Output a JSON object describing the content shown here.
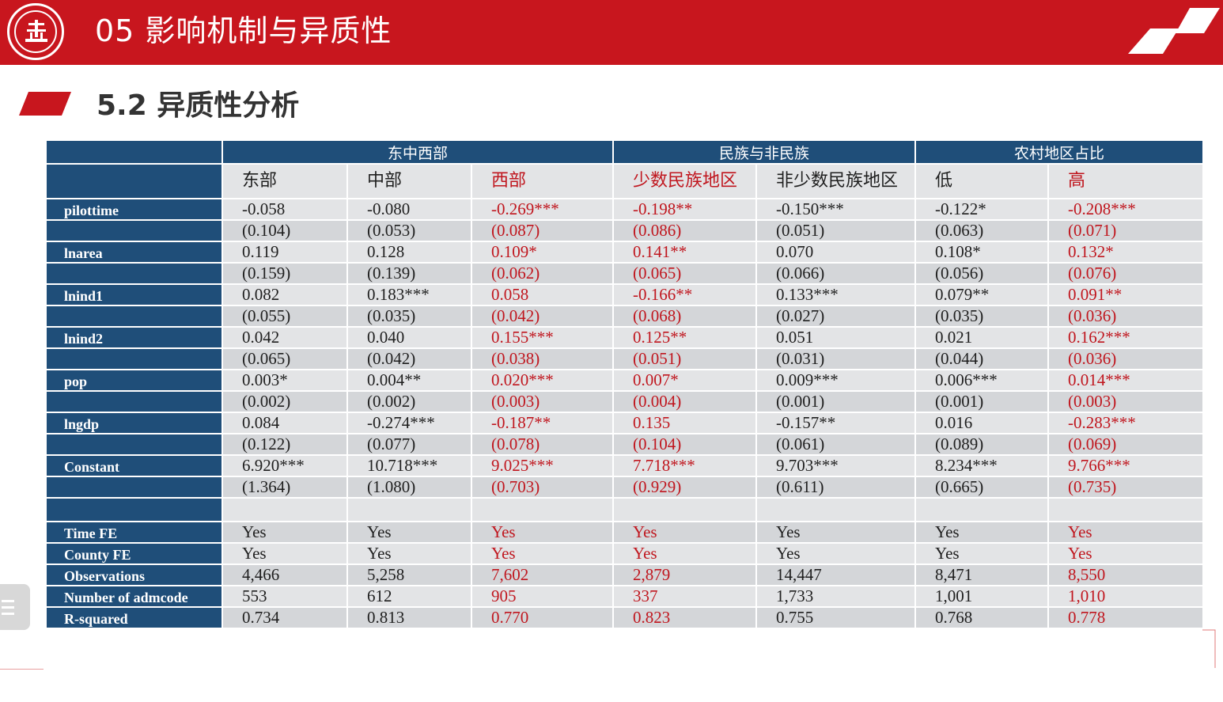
{
  "header": {
    "title": "05 影响机制与异质性"
  },
  "section": {
    "title": "5.2 异质性分析"
  },
  "colors": {
    "accent": "#c8161e",
    "table_header": "#1f4e79",
    "highlight_text": "#c0161e"
  },
  "table": {
    "groups": [
      "东中西部",
      "民族与非民族",
      "农村地区占比"
    ],
    "columns": [
      {
        "label": "东部",
        "highlight": false
      },
      {
        "label": "中部",
        "highlight": false
      },
      {
        "label": "西部",
        "highlight": true
      },
      {
        "label": "少数民族地区",
        "highlight": true
      },
      {
        "label": "非少数民族地区",
        "highlight": false
      },
      {
        "label": "低",
        "highlight": false
      },
      {
        "label": "高",
        "highlight": true
      }
    ],
    "rows": [
      {
        "label": "pilottime",
        "values": [
          "-0.058",
          "-0.080",
          "-0.269***",
          "-0.198**",
          "-0.150***",
          "-0.122*",
          "-0.208***"
        ]
      },
      {
        "label": "",
        "values": [
          "(0.104)",
          "(0.053)",
          "(0.087)",
          "(0.086)",
          "(0.051)",
          "(0.063)",
          "(0.071)"
        ]
      },
      {
        "label": "lnarea",
        "values": [
          "0.119",
          "0.128",
          "0.109*",
          "0.141**",
          "0.070",
          "0.108*",
          "0.132*"
        ]
      },
      {
        "label": "",
        "values": [
          "(0.159)",
          "(0.139)",
          "(0.062)",
          "(0.065)",
          "(0.066)",
          "(0.056)",
          "(0.076)"
        ]
      },
      {
        "label": "lnind1",
        "values": [
          "0.082",
          "0.183***",
          "0.058",
          "-0.166**",
          "0.133***",
          "0.079**",
          "0.091**"
        ]
      },
      {
        "label": "",
        "values": [
          "(0.055)",
          "(0.035)",
          "(0.042)",
          "(0.068)",
          "(0.027)",
          "(0.035)",
          "(0.036)"
        ]
      },
      {
        "label": "lnind2",
        "values": [
          "0.042",
          "0.040",
          "0.155***",
          "0.125**",
          "0.051",
          "0.021",
          "0.162***"
        ]
      },
      {
        "label": "",
        "values": [
          "(0.065)",
          "(0.042)",
          "(0.038)",
          "(0.051)",
          "(0.031)",
          "(0.044)",
          "(0.036)"
        ]
      },
      {
        "label": "pop",
        "values": [
          "0.003*",
          "0.004**",
          "0.020***",
          "0.007*",
          "0.009***",
          "0.006***",
          "0.014***"
        ]
      },
      {
        "label": "",
        "values": [
          "(0.002)",
          "(0.002)",
          "(0.003)",
          "(0.004)",
          "(0.001)",
          "(0.001)",
          "(0.003)"
        ]
      },
      {
        "label": "lngdp",
        "values": [
          "0.084",
          "-0.274***",
          "-0.187**",
          "0.135",
          "-0.157**",
          "0.016",
          "-0.283***"
        ]
      },
      {
        "label": "",
        "values": [
          "(0.122)",
          "(0.077)",
          "(0.078)",
          "(0.104)",
          "(0.061)",
          "(0.089)",
          "(0.069)"
        ]
      },
      {
        "label": "Constant",
        "values": [
          "6.920***",
          "10.718***",
          "9.025***",
          "7.718***",
          "9.703***",
          "8.234***",
          "9.766***"
        ]
      },
      {
        "label": "",
        "values": [
          "(1.364)",
          "(1.080)",
          "(0.703)",
          "(0.929)",
          "(0.611)",
          "(0.665)",
          "(0.735)"
        ]
      },
      {
        "label": "",
        "values": [
          "",
          "",
          "",
          "",
          "",
          "",
          ""
        ]
      },
      {
        "label": "Time FE",
        "values": [
          "Yes",
          "Yes",
          "Yes",
          "Yes",
          "Yes",
          "Yes",
          "Yes"
        ]
      },
      {
        "label": "County FE",
        "values": [
          "Yes",
          "Yes",
          "Yes",
          "Yes",
          "Yes",
          "Yes",
          "Yes"
        ]
      },
      {
        "label": "Observations",
        "values": [
          "4,466",
          "5,258",
          "7,602",
          "2,879",
          "14,447",
          "8,471",
          "8,550"
        ]
      },
      {
        "label": "Number of admcode",
        "values": [
          "553",
          "612",
          "905",
          "337",
          "1,733",
          "1,001",
          "1,010"
        ]
      },
      {
        "label": "R-squared",
        "values": [
          "0.734",
          "0.813",
          "0.770",
          "0.823",
          "0.755",
          "0.768",
          "0.778"
        ]
      }
    ]
  }
}
